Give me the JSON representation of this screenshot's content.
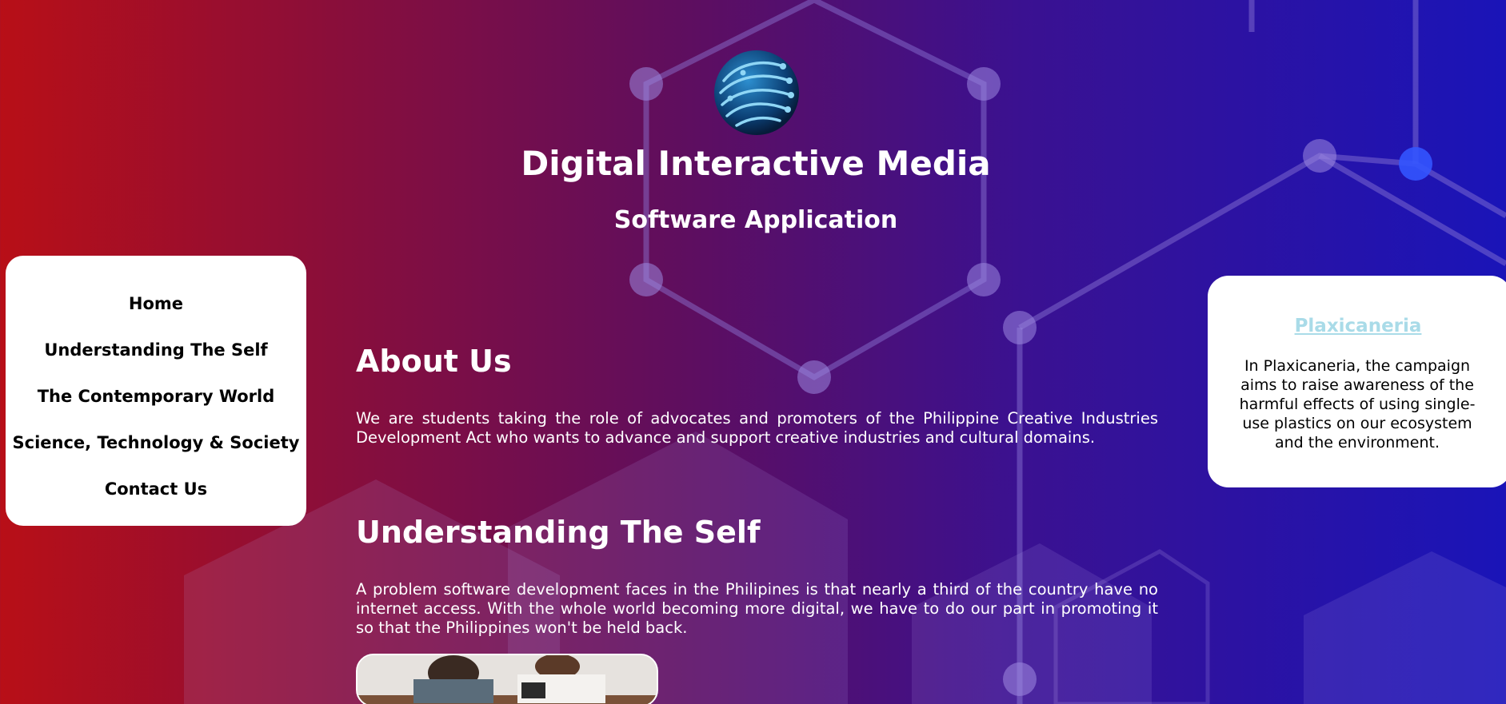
{
  "header": {
    "logo_icon": "circuit-globe-icon",
    "title": "Digital Interactive Media",
    "subtitle": "Software Application"
  },
  "nav": {
    "items": [
      {
        "label": "Home"
      },
      {
        "label": "Understanding The Self"
      },
      {
        "label": "The Contemporary World"
      },
      {
        "label": "Science, Technology & Society"
      },
      {
        "label": "Contact Us"
      }
    ]
  },
  "main": {
    "sections": [
      {
        "heading": "About Us",
        "text": "We are students taking the role of advocates and promoters of the Philippine Creative Industries Development Act who wants to advance and support creative industries and cultural domains."
      },
      {
        "heading": "Understanding The Self",
        "text": "A problem software development faces in the Philipines is that nearly a third of the country have no internet access. With the whole world becoming more digital, we have to do our part in promoting it so that the Philippines won't be held back."
      }
    ]
  },
  "aside": {
    "link_label": "Plaxicaneria",
    "text": "In Plaxicaneria, the campaign aims to raise awareness of the harmful effects of using single-use plastics on our ecosystem and the environment."
  },
  "colors": {
    "gradient_left": "#b80f17",
    "gradient_right": "#1a14b8",
    "link": "#a9dbe8",
    "panel": "#ffffff"
  }
}
